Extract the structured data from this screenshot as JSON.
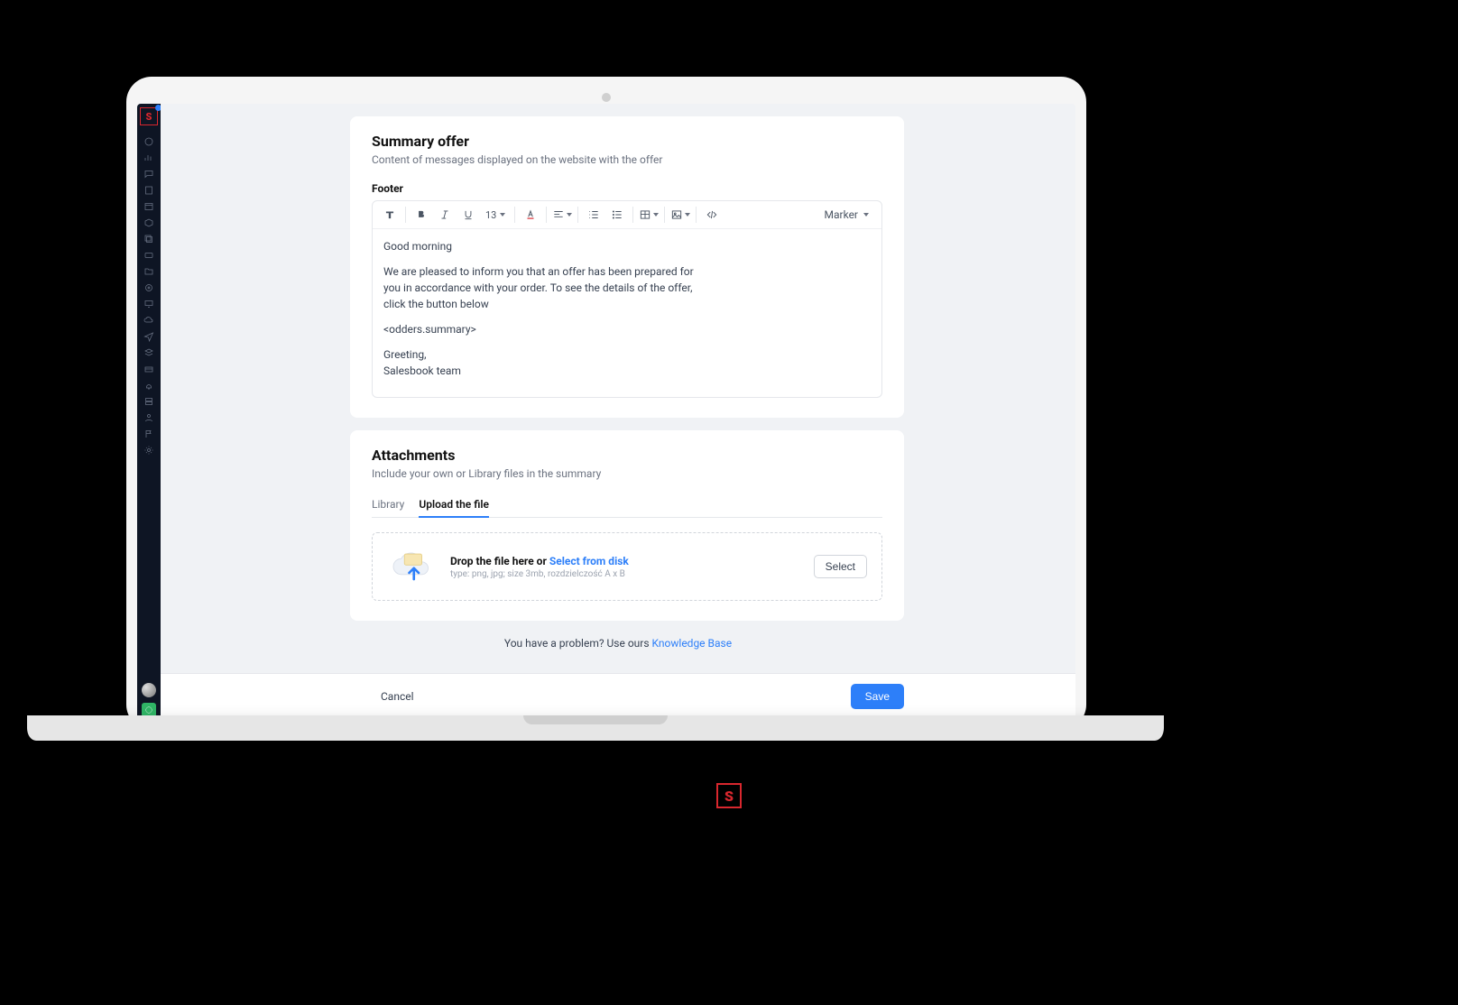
{
  "card1": {
    "title": "Summary offer",
    "subtitle": "Content of messages displayed on the website with the offer",
    "footer_label": "Footer",
    "font_size": "13",
    "marker": "Marker",
    "body_greeting": "Good morning",
    "body_p1": "We are pleased to inform you that an offer has been prepared for you in accordance with your order. To see the details of the offer, click the button below",
    "body_tag": "<odders.summary>",
    "body_sign1": "Greeting,",
    "body_sign2": "Salesbook team"
  },
  "card2": {
    "title": "Attachments",
    "subtitle": "Include your own or Library files in the summary",
    "tab_library": "Library",
    "tab_upload": "Upload the file",
    "drop_label": "Drop the file here or ",
    "drop_link": "Select from disk",
    "drop_hint": "type: png, jpg; size 3mb, rozdzielczość A x B",
    "select": "Select"
  },
  "help": {
    "text": "You have a problem? Use ours ",
    "link": "Knowledge Base"
  },
  "actions": {
    "cancel": "Cancel",
    "save": "Save"
  },
  "logo_char": "S"
}
